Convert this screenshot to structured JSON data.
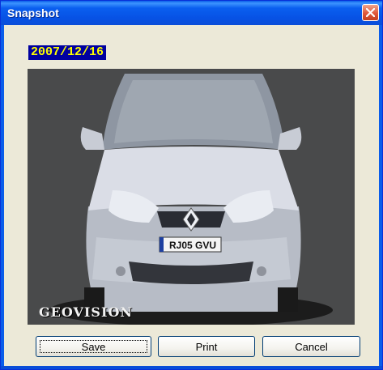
{
  "window": {
    "title": "Snapshot"
  },
  "date_stamp": "2007/12/16",
  "snapshot": {
    "watermark": "GEOVISION",
    "plate_text": "RJ05 GVU"
  },
  "buttons": {
    "save": "Save",
    "print": "Print",
    "cancel": "Cancel"
  },
  "colors": {
    "titlebar": "#0A5DEA",
    "date_bg": "#0000A0",
    "date_fg": "#FFFF00",
    "window_bg": "#ECE9D8"
  }
}
